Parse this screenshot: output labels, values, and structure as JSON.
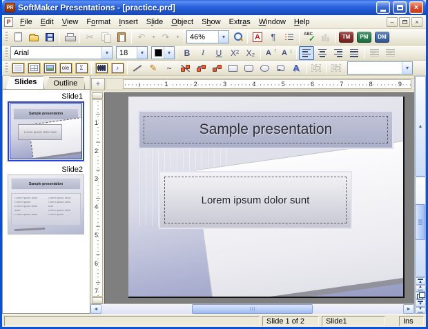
{
  "window": {
    "title": "SoftMaker Presentations - [practice.prd]",
    "app_icon_text": "PR",
    "doc_icon_text": "P",
    "close_glyph": "×"
  },
  "menu": {
    "items": [
      {
        "label": "File",
        "u": 0
      },
      {
        "label": "Edit",
        "u": 0
      },
      {
        "label": "View",
        "u": 0
      },
      {
        "label": "Format",
        "u": 1
      },
      {
        "label": "Insert",
        "u": 0
      },
      {
        "label": "Slide",
        "u": 1
      },
      {
        "label": "Object",
        "u": 0
      },
      {
        "label": "Show",
        "u": 1
      },
      {
        "label": "Extras",
        "u": 4
      },
      {
        "label": "Window",
        "u": 0
      },
      {
        "label": "Help",
        "u": 0
      }
    ]
  },
  "toolbar_standard": {
    "zoom_value": "46%",
    "spell_abc": "ABC",
    "spell_check": "✓",
    "tm_label": "TM",
    "pm_label": "PM",
    "dm_label": "DM"
  },
  "toolbar_format": {
    "font_name": "Arial",
    "font_size": "18",
    "bold": "B",
    "italic": "I",
    "underline": "U",
    "superscript": "X²",
    "subscript": "X₂",
    "grow_letter": "A",
    "grow_arrow": "↑",
    "shrink_letter": "A",
    "shrink_arrow": "↓"
  },
  "toolbar_object": {
    "ole_label": "ole",
    "formula_glyph": "Σ",
    "sound_glyph": "♪",
    "freehand_glyph": "✎",
    "curve_glyph": "~",
    "textart_glyph": "A",
    "object_combo_value": ""
  },
  "icons": {
    "cut-icon": "✂",
    "undo-icon": "↶",
    "redo-icon": "↷",
    "dropdown-icon": "▾",
    "character-icon": "A",
    "paragraph-icon": "¶",
    "ruler-corner-icon": "+",
    "scroll-up-icon": "▲",
    "scroll-down-icon": "▼",
    "scroll-left-icon": "◄",
    "scroll-right-icon": "►",
    "nav-triangle-up": "▲",
    "nav-triangle-down": "▼",
    "mdi-minimize-icon": "–",
    "mdi-close-icon": "×"
  },
  "panel": {
    "tabs": {
      "slides": "Slides",
      "outline": "Outline"
    },
    "slides": [
      {
        "label": "Slide1",
        "title": "Sample presentation",
        "body": "Lorem ipsum dolor sunt",
        "selected": true
      },
      {
        "label": "Slide2",
        "title": "Sample presentation",
        "columns": [
          [
            "Lorem ipsum dolor",
            "Lorem ipsum",
            "Lorem ipsum dolor",
            "sunt",
            "Lorem ipsum dolor"
          ],
          [
            "Lorem ipsum dolor",
            "Lorem ipsum dolor",
            "sunt",
            "Lorem ipsum dolor",
            "Lorem ipsum"
          ]
        ]
      }
    ]
  },
  "ruler": {
    "h_numbers": [
      "1",
      "2",
      "3",
      "4",
      "5",
      "6",
      "7",
      "8",
      "9"
    ],
    "v_numbers": [
      "1",
      "2",
      "3",
      "4",
      "5",
      "6",
      "7"
    ]
  },
  "statusbar": {
    "page_info": "Slide 1 of 2",
    "slide_name": "Slide1",
    "insert_mode": "Ins"
  },
  "colors": {
    "titlebar_blue": "#2a62dd",
    "window_border": "#0a51d6",
    "toolbar_bg": "#eeebdd",
    "workspace_gray": "#7f7f7f",
    "selection_blue": "#2740d6",
    "slide_top": "#ececf1",
    "slide_bottom": "#969bc3",
    "brand_tm": "#6e1f1e",
    "brand_pm": "#1d6b41",
    "brand_dm": "#2f5590"
  }
}
